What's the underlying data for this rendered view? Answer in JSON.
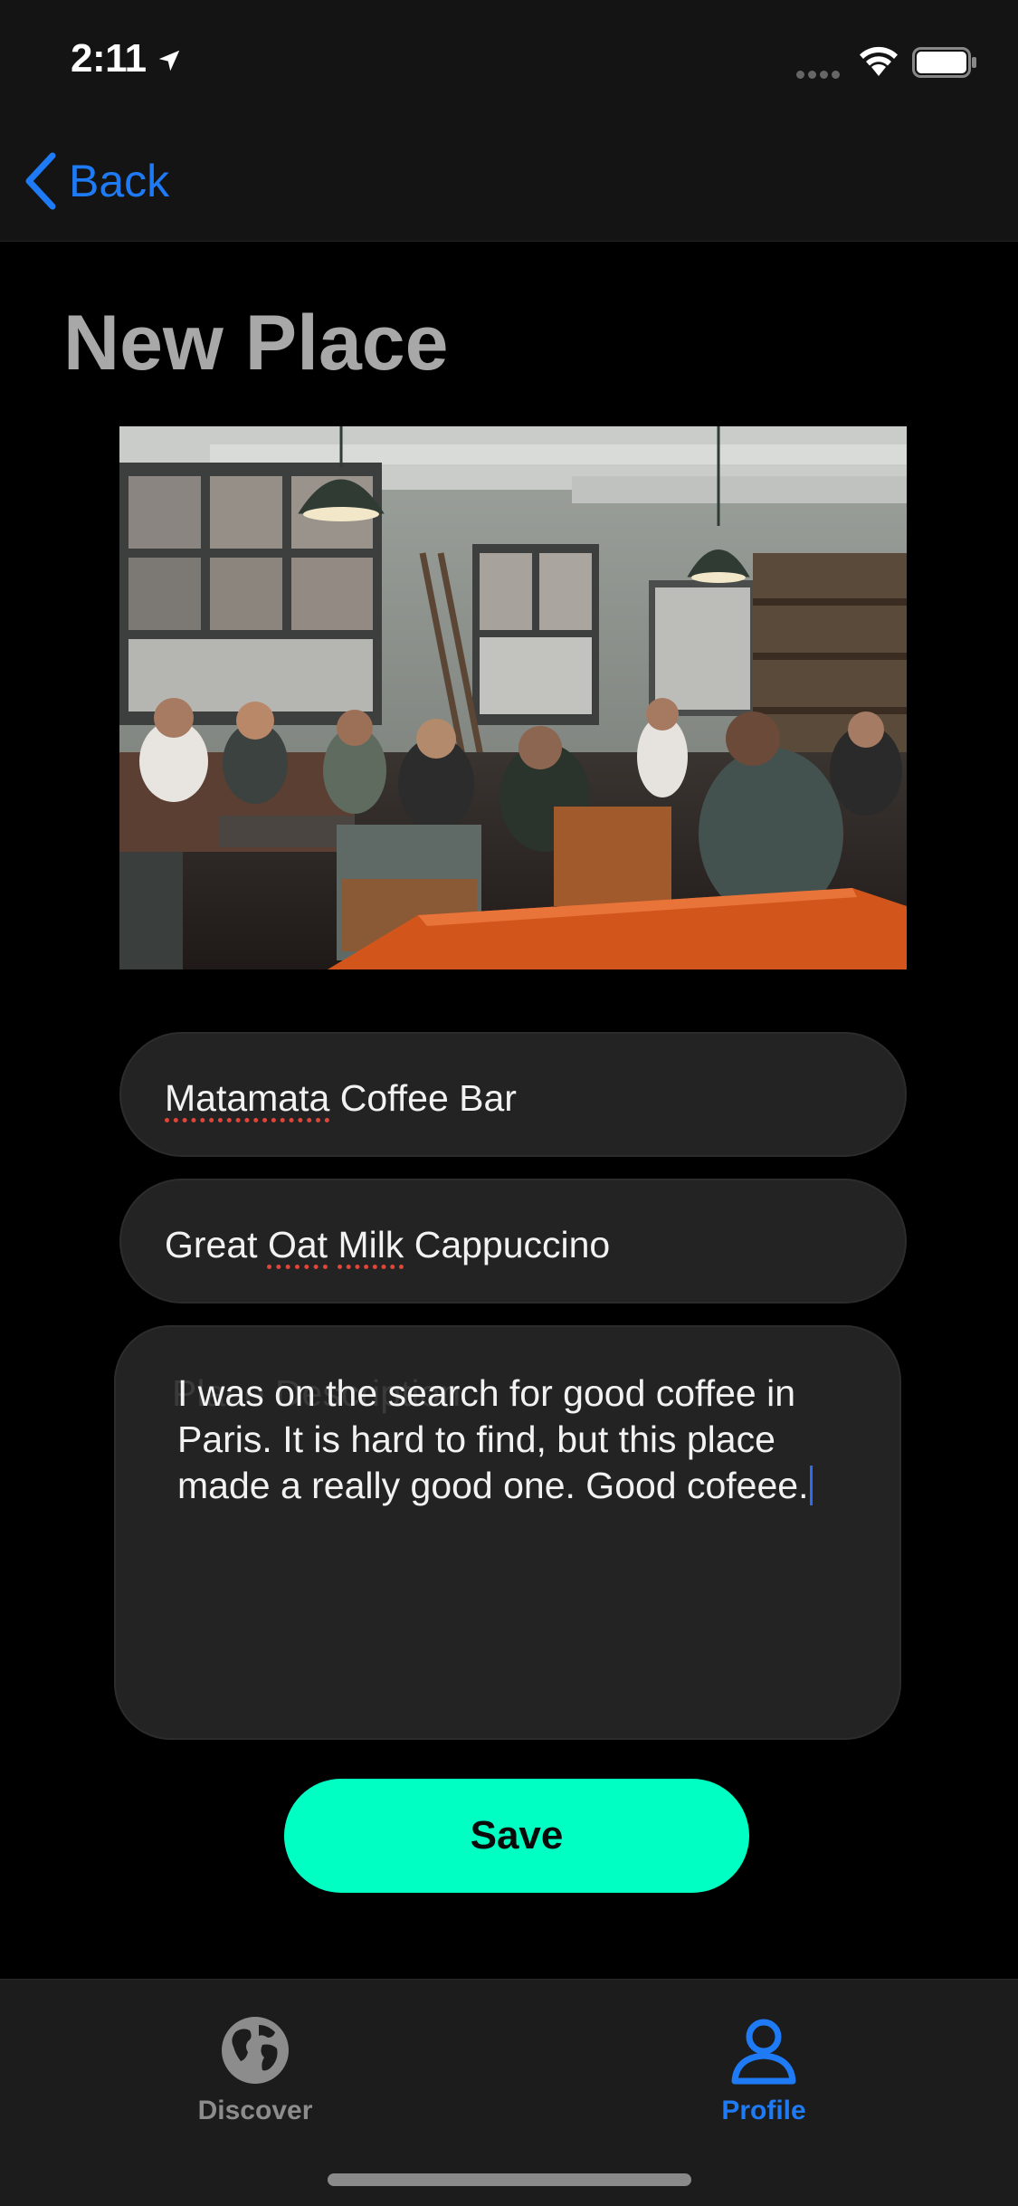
{
  "status_bar": {
    "time": "2:11"
  },
  "nav": {
    "back_label": "Back"
  },
  "page": {
    "title": "New Place"
  },
  "form": {
    "name_value": "Matamata Coffee Bar",
    "name_parts": [
      "Matamata",
      " Coffee Bar"
    ],
    "subtitle_value": "Great Oat Milk Cappuccino",
    "subtitle_parts": [
      "Great ",
      "Oat",
      " ",
      "Milk",
      " Cappuccino"
    ],
    "description_placeholder": "Place Description",
    "description_value": "I was on the search for good coffee in Paris. It is hard to find, but this place made a really good one. Good cofeee.",
    "save_label": "Save"
  },
  "tab_bar": {
    "tabs": [
      {
        "label": "Discover",
        "icon": "globe-icon",
        "active": false
      },
      {
        "label": "Profile",
        "icon": "person-icon",
        "active": true
      }
    ]
  },
  "colors": {
    "accent": "#1E7BF5",
    "save_button": "#00FFC3",
    "background": "#000000",
    "field_background": "#232323",
    "title_gray": "#A8A8A8"
  }
}
